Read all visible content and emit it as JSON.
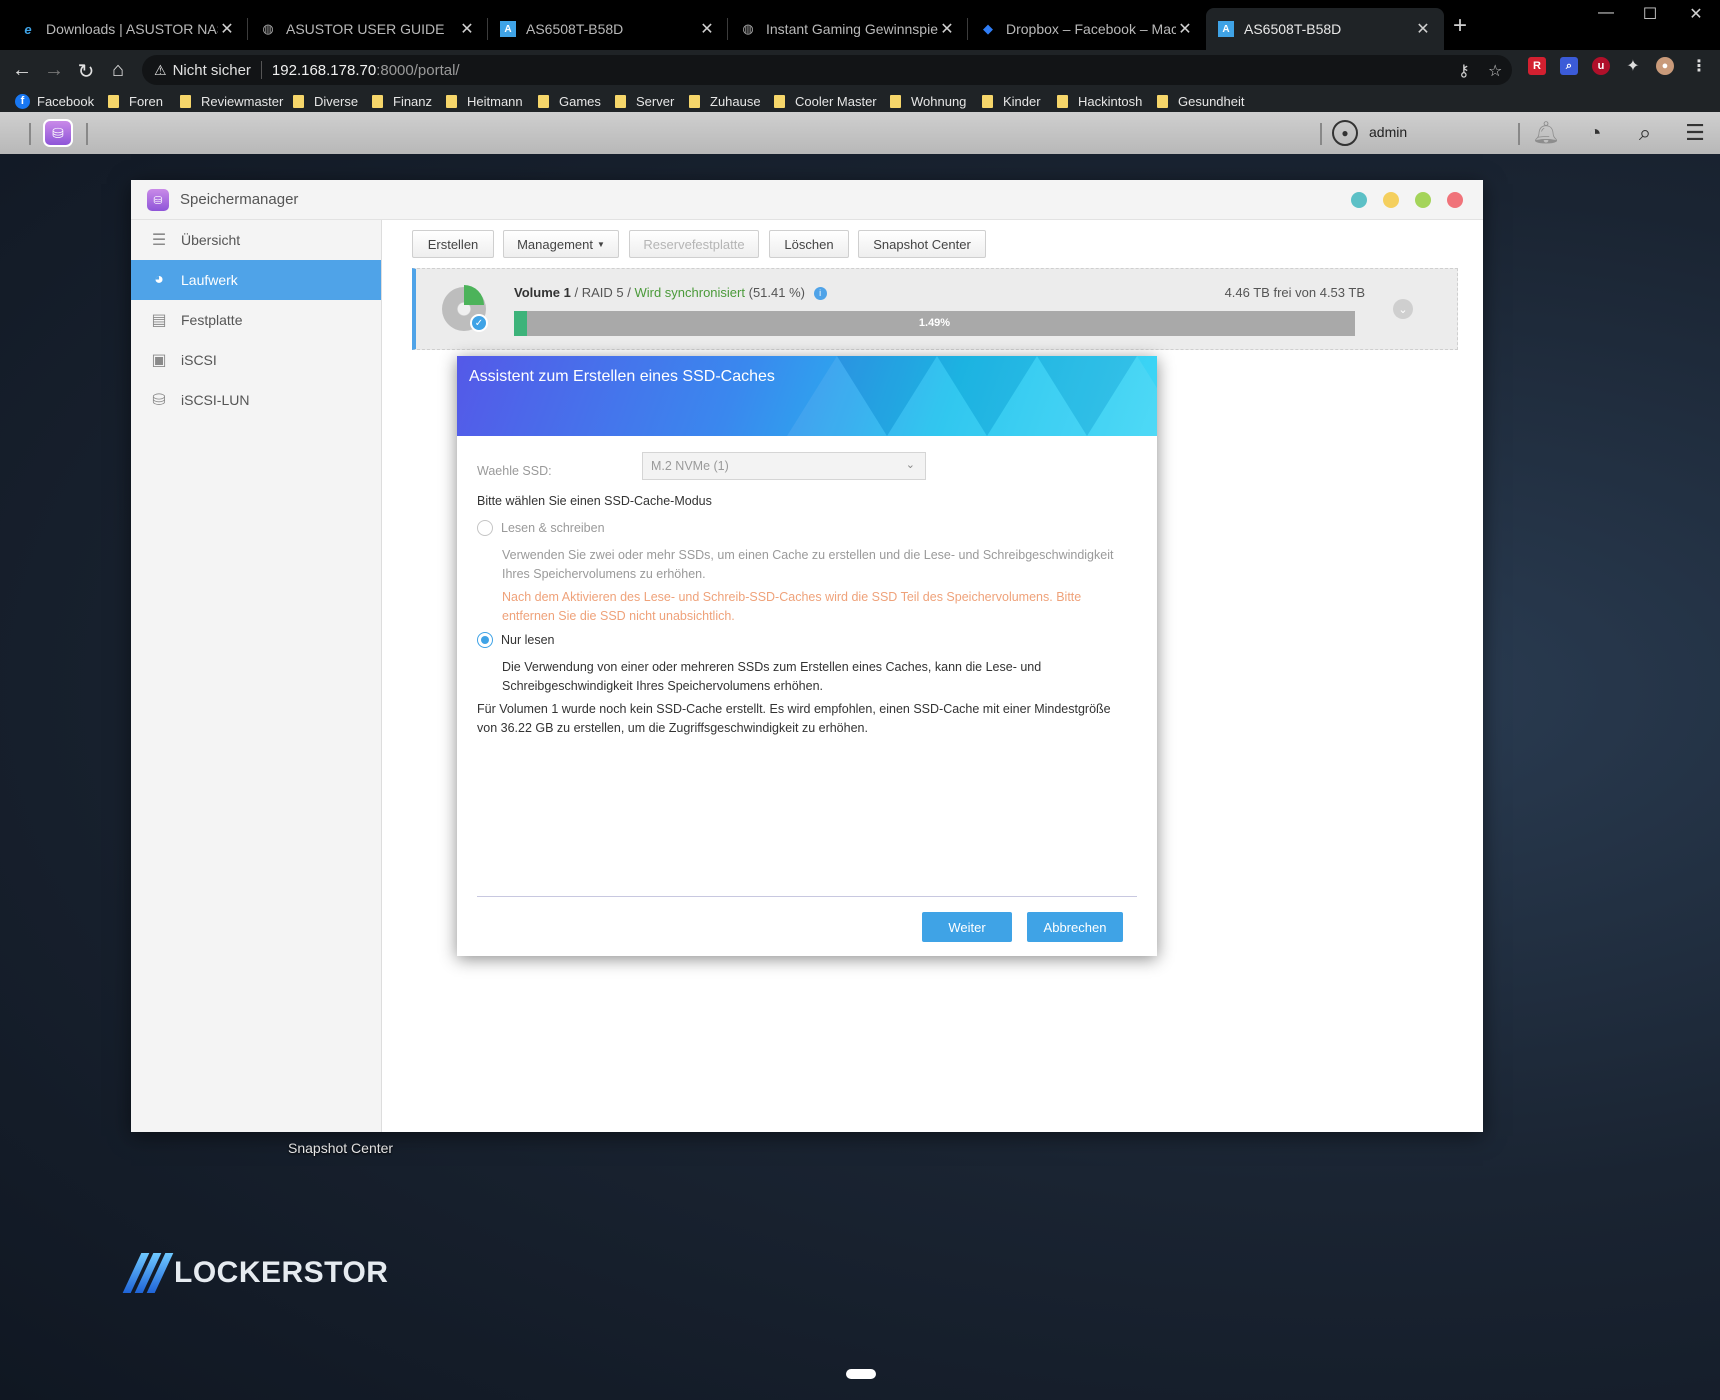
{
  "browser": {
    "tabs": [
      {
        "title": "Downloads | ASUSTOR NAS",
        "icon": "asustor-e-icon",
        "active": false
      },
      {
        "title": "ASUSTOR USER GUIDE",
        "icon": "globe-icon",
        "active": false
      },
      {
        "title": "AS6508T-B58D",
        "icon": "asustor-a-icon",
        "active": false
      },
      {
        "title": "Instant Gaming Gewinnspiel | Ha",
        "icon": "globe-icon",
        "active": false
      },
      {
        "title": "Dropbox – Facebook – Machen S",
        "icon": "dropbox-icon",
        "active": false
      },
      {
        "title": "AS6508T-B58D",
        "icon": "asustor-a-icon",
        "active": true
      }
    ],
    "address": {
      "security_label": "Nicht sicher",
      "host": "192.168.178.70",
      "rest": ":8000/portal/"
    },
    "bookmarks": [
      "Facebook",
      "Foren",
      "Reviewmaster",
      "Diverse",
      "Finanz",
      "Heitmann",
      "Games",
      "Server",
      "Zuhause",
      "Cooler Master",
      "Wohnung",
      "Kinder",
      "Hackintosh",
      "Gesundheit"
    ]
  },
  "taskbar": {
    "username": "admin"
  },
  "desktop": {
    "shortcut_label": "Snapshot Center",
    "logo_text": "LOCKERSTOR"
  },
  "app": {
    "title": "Speichermanager",
    "sidebar": [
      {
        "label": "Übersicht",
        "icon": "list-icon",
        "active": false
      },
      {
        "label": "Laufwerk",
        "icon": "volume-icon",
        "active": true
      },
      {
        "label": "Festplatte",
        "icon": "disk-icon",
        "active": false
      },
      {
        "label": "iSCSI",
        "icon": "iscsi-icon",
        "active": false
      },
      {
        "label": "iSCSI-LUN",
        "icon": "database-icon",
        "active": false
      }
    ],
    "toolbar": {
      "create": "Erstellen",
      "management": "Management",
      "spare": "Reservefestplatte",
      "delete": "Löschen",
      "snapshot": "Snapshot Center"
    },
    "volume": {
      "name": "Volume 1",
      "raid": "RAID 5",
      "status": "Wird synchronisiert",
      "sync_pct": "(51.41 %)",
      "free": "4.46 TB frei von 4.53 TB",
      "used_pct_label": "1.49%",
      "used_fraction": 0.0149
    }
  },
  "dialog": {
    "title": "Assistent zum Erstellen eines SSD-Caches",
    "ssd_label": "Waehle SSD:",
    "ssd_value": "M.2 NVMe (1)",
    "mode_label": "Bitte wählen Sie einen SSD-Cache-Modus",
    "rw_label": "Lesen & schreiben",
    "rw_desc": "Verwenden Sie zwei oder mehr SSDs, um einen Cache zu erstellen und die Lese- und Schreibgeschwindigkeit Ihres Speichervolumens zu erhöhen.",
    "rw_warning": "Nach dem Aktivieren des Lese- und Schreib-SSD-Caches wird die SSD Teil des Speichervolumens. Bitte entfernen Sie die SSD nicht unabsichtlich.",
    "ro_label": "Nur lesen",
    "ro_desc": "Die Verwendung von einer oder mehreren SSDs zum Erstellen eines Caches, kann die Lese- und Schreibgeschwindigkeit Ihres Speichervolumens erhöhen.",
    "note": "Für Volumen 1 wurde noch kein SSD-Cache erstellt. Es wird empfohlen, einen SSD-Cache mit einer Mindestgröße von 36.22 GB zu erstellen, um die Zugriffsgeschwindigkeit zu erhöhen.",
    "next": "Weiter",
    "cancel": "Abbrechen"
  },
  "colors": {
    "accent": "#3fa3e6",
    "sidebar_active": "#4fa3e8",
    "sync_green": "#4b9a3a",
    "warning_orange": "#efa27a"
  }
}
